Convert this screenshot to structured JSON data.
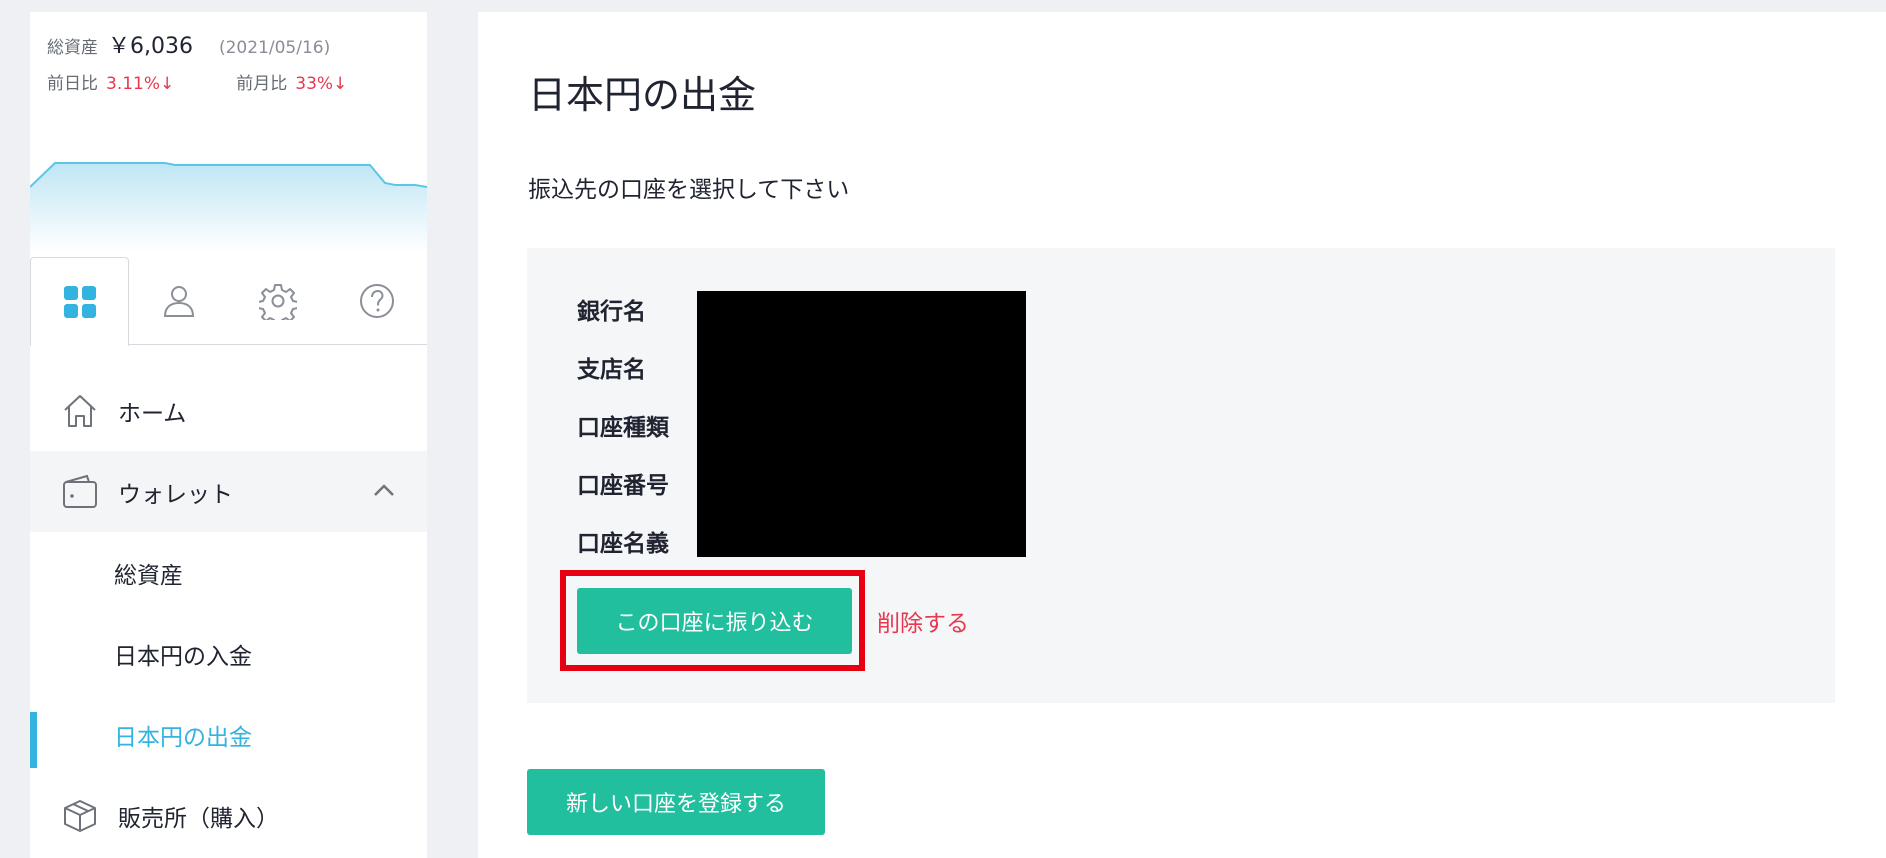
{
  "sidebar": {
    "total_assets_label": "総資産",
    "total_assets_value": "￥6,036",
    "as_of_date": "(2021/05/16)",
    "day_change_label": "前日比",
    "day_change_value": "3.11%↓",
    "month_change_label": "前月比",
    "month_change_value": "33%↓",
    "tabs": [
      {
        "icon": "dashboard-grid-icon",
        "active": true
      },
      {
        "icon": "user-icon",
        "active": false
      },
      {
        "icon": "gear-icon",
        "active": false
      },
      {
        "icon": "help-icon",
        "active": false
      }
    ],
    "nav": {
      "home": "ホーム",
      "wallet": "ウォレット",
      "wallet_sub": [
        "総資産",
        "日本円の入金",
        "日本円の出金"
      ],
      "exchange": "販売所（購入）"
    }
  },
  "main": {
    "title": "日本円の出金",
    "instruction": "振込先の口座を選択して下さい",
    "account_fields": [
      "銀行名",
      "支店名",
      "口座種類",
      "口座番号",
      "口座名義"
    ],
    "transfer_button": "この口座に振り込む",
    "delete_link": "削除する",
    "register_button": "新しい口座を登録する"
  },
  "colors": {
    "accent": "#33b3e0",
    "button": "#22bf9f",
    "danger": "#e8384f",
    "highlight": "#e60012"
  }
}
